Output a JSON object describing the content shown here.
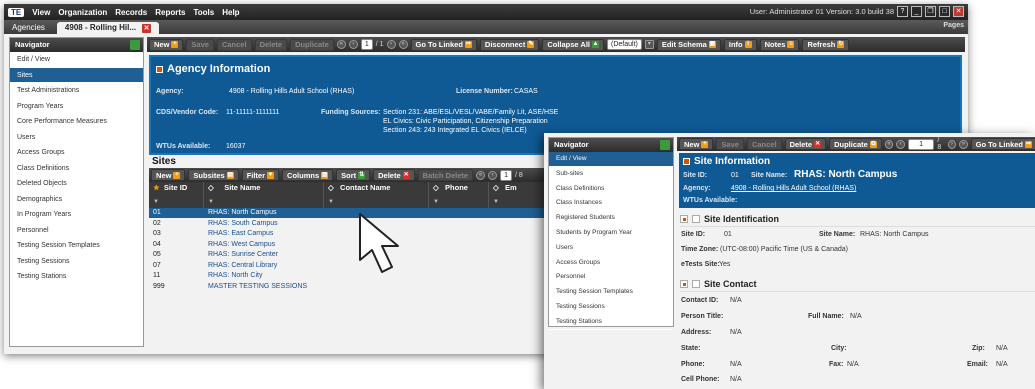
{
  "menubar": {
    "logo": "TE",
    "items": [
      "View",
      "Organization",
      "Records",
      "Reports",
      "Tools",
      "Help"
    ],
    "user_info": "User: Administrator 01   Version: 3.0 build 38"
  },
  "tabs": {
    "agencies": "Agencies",
    "active": "4908 - Rolling Hil...",
    "pages": "Pages"
  },
  "navigator": {
    "title": "Navigator",
    "items": [
      "Edit / View",
      "Sites",
      "Test Administrations",
      "Program Years",
      "Core Performance Measures",
      "Users",
      "Access Groups",
      "Class Definitions",
      "Deleted Objects",
      "Demographics",
      "In Program Years",
      "Personnel",
      "Testing Session Templates",
      "Testing Sessions",
      "Testing Stations"
    ],
    "selected": "Sites"
  },
  "toolbar": {
    "new": "New",
    "save": "Save",
    "cancel": "Cancel",
    "delete": "Delete",
    "duplicate": "Duplicate",
    "page": "1",
    "page_total": "/ 1",
    "go_linked": "Go To Linked",
    "disconnect": "Disconnect",
    "collapse": "Collapse All",
    "view": "(Default)",
    "edit_schema": "Edit Schema",
    "info": "Info",
    "notes": "Notes",
    "refresh": "Refresh"
  },
  "agency": {
    "title": "Agency Information",
    "agency_label": "Agency:",
    "agency_value": "4908 - Rolling Hills Adult School (RHAS)",
    "license_label": "License Number:",
    "license_value": "CASAS",
    "cds_label": "CDS/Vendor Code:",
    "cds_value": "11-11111-1111111",
    "funding_label": "Funding Sources:",
    "funding_lines": [
      "Section 231: ABE/ESL/VESL/VABE/Family Lit, ASE/HSE",
      "EL Civics: Civic Participation, Citizenship Preparation",
      "Section 243: 243 Integrated EL Civics (IELCE)"
    ],
    "wtu_label": "WTUs Available:",
    "wtu_value": "16037"
  },
  "sites": {
    "title": "Sites",
    "tools": {
      "new": "New",
      "subsites": "Subsites",
      "filter": "Filter",
      "columns": "Columns",
      "sort": "Sort",
      "delete": "Delete",
      "batch_delete": "Batch Delete",
      "page": "1",
      "page_total": "/ 8"
    },
    "columns": [
      "Site ID",
      "Site Name",
      "Contact Name",
      "Phone",
      "Em"
    ],
    "rows": [
      {
        "id": "01",
        "name": "RHAS: North Campus"
      },
      {
        "id": "02",
        "name": "RHAS: South Campus"
      },
      {
        "id": "03",
        "name": "RHAS: East Campus"
      },
      {
        "id": "04",
        "name": "RHAS: West Campus"
      },
      {
        "id": "05",
        "name": "RHAS: Sunrise Center"
      },
      {
        "id": "07",
        "name": "RHAS: Central Library"
      },
      {
        "id": "11",
        "name": "RHAS: North City"
      },
      {
        "id": "999",
        "name": "MASTER TESTING SESSIONS"
      }
    ],
    "selected_row": 0
  },
  "navigator2": {
    "title": "Navigator",
    "items": [
      "Edit / View",
      "Sub-sites",
      "Class Definitions",
      "Class Instances",
      "Registered Students",
      "Students by Program Year",
      "Users",
      "Access Groups",
      "Personnel",
      "Testing Session Templates",
      "Testing Sessions",
      "Testing Stations"
    ],
    "selected": "Edit / View"
  },
  "toolbar2": {
    "new": "New",
    "save": "Save",
    "cancel": "Cancel",
    "delete": "Delete",
    "duplicate": "Duplicate",
    "page": "1",
    "page_total": "/ 8",
    "go_linked": "Go To Linked"
  },
  "site_info": {
    "title": "Site Information",
    "site_id_label": "Site ID:",
    "site_id_value": "01",
    "site_name_label": "Site Name:",
    "site_name_value": "RHAS: North Campus",
    "agency_label": "Agency:",
    "agency_value": "4908 - Rolling Hills Adult School (RHAS)",
    "wtu_label": "WTUs Available:"
  },
  "site_identification": {
    "title": "Site Identification",
    "site_id_label": "Site ID:",
    "site_id_value": "01",
    "site_name_label": "Site Name:",
    "site_name_value": "RHAS: North Campus",
    "tz_label": "Time Zone:",
    "tz_value": "(UTC-08:00) Pacific Time (US & Canada)",
    "etests_label": "eTests Site:",
    "etests_value": "Yes"
  },
  "site_contact": {
    "title": "Site Contact",
    "contact_id_label": "Contact ID:",
    "contact_id_value": "N/A",
    "person_title_label": "Person Title:",
    "full_name_label": "Full Name:",
    "full_name_value": "N/A",
    "address_label": "Address:",
    "address_value": "N/A",
    "state_label": "State:",
    "city_label": "City:",
    "zip_label": "Zip:",
    "zip_value": "N/A",
    "phone_label": "Phone:",
    "phone_value": "N/A",
    "fax_label": "Fax:",
    "fax_value": "N/A",
    "email_label": "Email:",
    "email_value": "N/A",
    "cell_label": "Cell Phone:",
    "cell_value": "N/A"
  }
}
